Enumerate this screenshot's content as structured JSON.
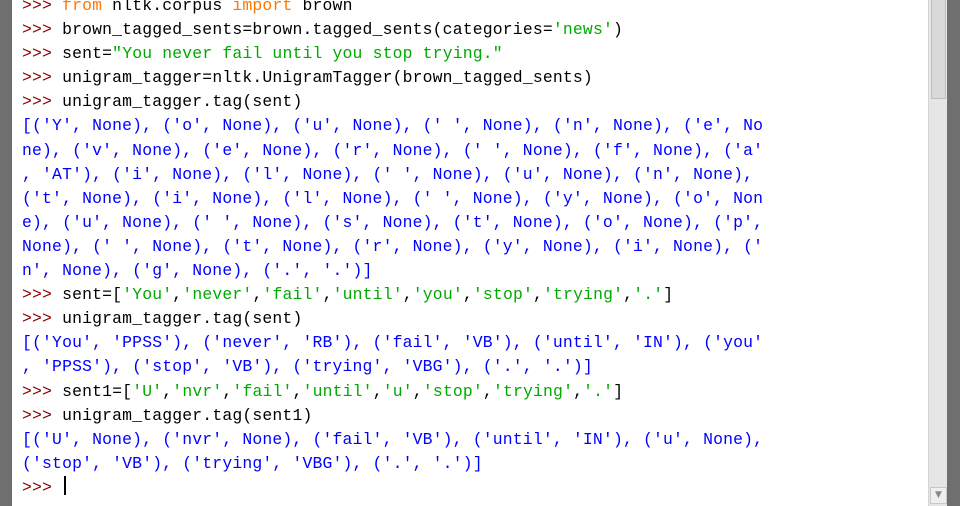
{
  "shell_lines": [
    [
      {
        "t": "prompt",
        "v": ">>> "
      },
      {
        "t": "kw",
        "v": "from"
      },
      {
        "t": "code",
        "v": " nltk.corpus "
      },
      {
        "t": "kw",
        "v": "import"
      },
      {
        "t": "code",
        "v": " brown"
      }
    ],
    [
      {
        "t": "prompt",
        "v": ">>> "
      },
      {
        "t": "code",
        "v": "brown_tagged_sents=brown.tagged_sents(categories="
      },
      {
        "t": "str",
        "v": "'news'"
      },
      {
        "t": "code",
        "v": ")"
      }
    ],
    [
      {
        "t": "prompt",
        "v": ">>> "
      },
      {
        "t": "code",
        "v": "sent="
      },
      {
        "t": "str",
        "v": "\"You never fail until you stop trying.\""
      }
    ],
    [
      {
        "t": "prompt",
        "v": ">>> "
      },
      {
        "t": "code",
        "v": "unigram_tagger=nltk.UnigramTagger(brown_tagged_sents)"
      }
    ],
    [
      {
        "t": "prompt",
        "v": ">>> "
      },
      {
        "t": "code",
        "v": "unigram_tagger.tag(sent)"
      }
    ],
    [
      {
        "t": "out",
        "v": "[('Y', None), ('o', None), ('u', None), (' ', None), ('n', None), ('e', No"
      }
    ],
    [
      {
        "t": "out",
        "v": "ne), ('v', None), ('e', None), ('r', None), (' ', None), ('f', None), ('a'"
      }
    ],
    [
      {
        "t": "out",
        "v": ", 'AT'), ('i', None), ('l', None), (' ', None), ('u', None), ('n', None),"
      }
    ],
    [
      {
        "t": "out",
        "v": "('t', None), ('i', None), ('l', None), (' ', None), ('y', None), ('o', Non"
      }
    ],
    [
      {
        "t": "out",
        "v": "e), ('u', None), (' ', None), ('s', None), ('t', None), ('o', None), ('p',"
      }
    ],
    [
      {
        "t": "out",
        "v": "None), (' ', None), ('t', None), ('r', None), ('y', None), ('i', None), ('"
      }
    ],
    [
      {
        "t": "out",
        "v": "n', None), ('g', None), ('.', '.')]"
      }
    ],
    [
      {
        "t": "prompt",
        "v": ">>> "
      },
      {
        "t": "code",
        "v": "sent=["
      },
      {
        "t": "str",
        "v": "'You'"
      },
      {
        "t": "code",
        "v": ","
      },
      {
        "t": "str",
        "v": "'never'"
      },
      {
        "t": "code",
        "v": ","
      },
      {
        "t": "str",
        "v": "'fail'"
      },
      {
        "t": "code",
        "v": ","
      },
      {
        "t": "str",
        "v": "'until'"
      },
      {
        "t": "code",
        "v": ","
      },
      {
        "t": "str",
        "v": "'you'"
      },
      {
        "t": "code",
        "v": ","
      },
      {
        "t": "str",
        "v": "'stop'"
      },
      {
        "t": "code",
        "v": ","
      },
      {
        "t": "str",
        "v": "'trying'"
      },
      {
        "t": "code",
        "v": ","
      },
      {
        "t": "str",
        "v": "'.'"
      },
      {
        "t": "code",
        "v": "]"
      }
    ],
    [
      {
        "t": "prompt",
        "v": ">>> "
      },
      {
        "t": "code",
        "v": "unigram_tagger.tag(sent)"
      }
    ],
    [
      {
        "t": "out",
        "v": "[('You', 'PPSS'), ('never', 'RB'), ('fail', 'VB'), ('until', 'IN'), ('you'"
      }
    ],
    [
      {
        "t": "out",
        "v": ", 'PPSS'), ('stop', 'VB'), ('trying', 'VBG'), ('.', '.')]"
      }
    ],
    [
      {
        "t": "prompt",
        "v": ">>> "
      },
      {
        "t": "code",
        "v": "sent1=["
      },
      {
        "t": "str",
        "v": "'U'"
      },
      {
        "t": "code",
        "v": ","
      },
      {
        "t": "str",
        "v": "'nvr'"
      },
      {
        "t": "code",
        "v": ","
      },
      {
        "t": "str",
        "v": "'fail'"
      },
      {
        "t": "code",
        "v": ","
      },
      {
        "t": "str",
        "v": "'until'"
      },
      {
        "t": "code",
        "v": ","
      },
      {
        "t": "str",
        "v": "'u'"
      },
      {
        "t": "code",
        "v": ","
      },
      {
        "t": "str",
        "v": "'stop'"
      },
      {
        "t": "code",
        "v": ","
      },
      {
        "t": "str",
        "v": "'trying'"
      },
      {
        "t": "code",
        "v": ","
      },
      {
        "t": "str",
        "v": "'.'"
      },
      {
        "t": "code",
        "v": "]"
      }
    ],
    [
      {
        "t": "prompt",
        "v": ">>> "
      },
      {
        "t": "code",
        "v": "unigram_tagger.tag(sent1)"
      }
    ],
    [
      {
        "t": "out",
        "v": "[('U', None), ('nvr', None), ('fail', 'VB'), ('until', 'IN'), ('u', None),"
      }
    ],
    [
      {
        "t": "out",
        "v": "('stop', 'VB'), ('trying', 'VBG'), ('.', '.')]"
      }
    ]
  ],
  "input_line": {
    "prompt": ">>> "
  },
  "colors": {
    "prompt": "#8b0000",
    "keyword": "#ff7700",
    "string": "#00aa00",
    "output": "#0000ff",
    "code": "#000000",
    "background": "#ffffff"
  },
  "scrollbar": {
    "down_arrow_icon": "▼"
  }
}
